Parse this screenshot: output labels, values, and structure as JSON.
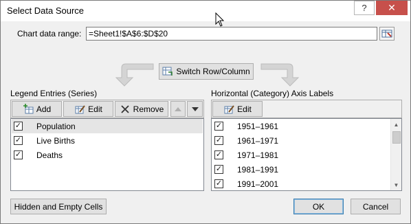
{
  "window": {
    "title": "Select Data Source",
    "help_glyph": "?",
    "close_glyph": "✕"
  },
  "range": {
    "label": "Chart data range:",
    "value": "=Sheet1!$A$6:$D$20"
  },
  "switch_button": "Switch Row/Column",
  "legend": {
    "heading": "Legend Entries (Series)",
    "buttons": {
      "add": "Add",
      "edit": "Edit",
      "remove": "Remove"
    },
    "items": [
      {
        "label": "Population",
        "checked": true,
        "selected": true
      },
      {
        "label": "Live Births",
        "checked": true,
        "selected": false
      },
      {
        "label": "Deaths",
        "checked": true,
        "selected": false
      }
    ]
  },
  "axis": {
    "heading": "Horizontal (Category) Axis Labels",
    "buttons": {
      "edit": "Edit"
    },
    "items": [
      {
        "label": "1951–1961",
        "checked": true
      },
      {
        "label": "1961–1971",
        "checked": true
      },
      {
        "label": "1971–1981",
        "checked": true
      },
      {
        "label": "1981–1991",
        "checked": true
      },
      {
        "label": "1991–2001",
        "checked": true
      }
    ]
  },
  "footer": {
    "hidden_cells": "Hidden and Empty Cells",
    "ok": "OK",
    "cancel": "Cancel"
  },
  "check_glyph": "✓",
  "colors": {
    "close_red": "#c7504b",
    "ok_border": "#3c7fb1",
    "window_bg": "#f0f0f0"
  }
}
